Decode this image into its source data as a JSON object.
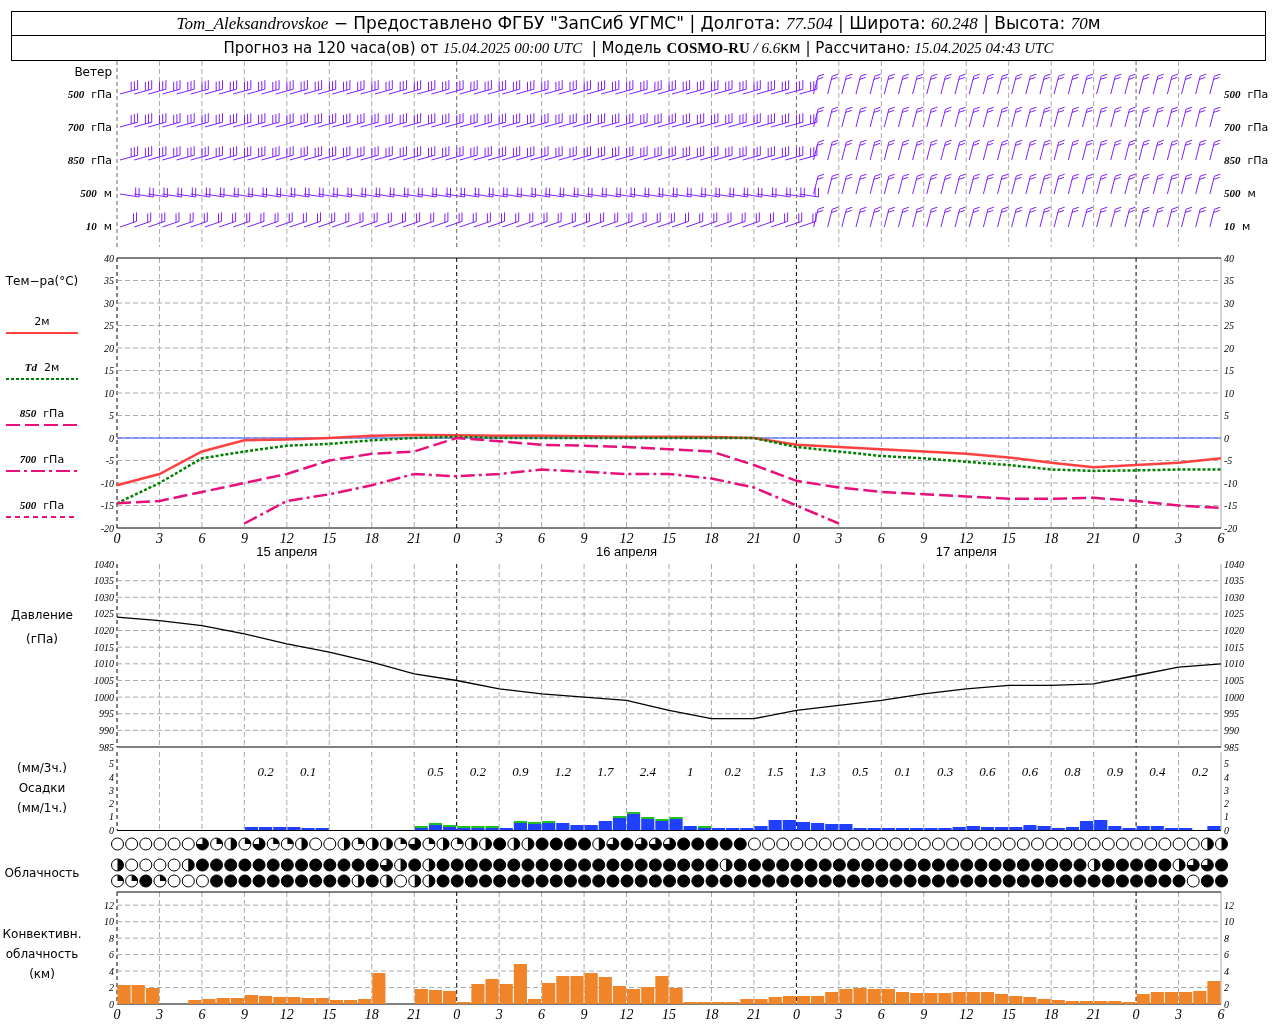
{
  "header": {
    "line_1": [
      {
        "text": "Tom_Aleksandrovskoe"
      },
      {
        "text": " − Предоставлено ФГБУ \"ЗапСиб УГМС\" | Долгота: "
      },
      {
        "text": "77.504"
      },
      {
        "text": " | Широта: "
      },
      {
        "text": "60.248"
      },
      {
        "text": " | Высота: "
      },
      {
        "text": "70"
      },
      {
        "text": "м"
      }
    ],
    "line_2": [
      {
        "text": "Прогноз на 120 часа(ов) от "
      },
      {
        "text": "15.04.2025 00:00 UTC"
      },
      {
        "text": "  | Модель "
      },
      {
        "text": "COSMO-RU"
      },
      {
        "text": " / 6.6"
      },
      {
        "text": "км | Рассчитано"
      },
      {
        "text": ": 15.04.2025 04:43 UTC"
      }
    ]
  },
  "wind": {
    "title": "Ветер",
    "levels": [
      {
        "number": "500",
        "unit": "гПа",
        "right_number": "500",
        "right_unit": "гПа"
      },
      {
        "number": "700",
        "unit": "гПа",
        "right_number": "700",
        "right_unit": "гПа"
      },
      {
        "number": "850",
        "unit": "гПа",
        "right_number": "850",
        "right_unit": "гПа"
      },
      {
        "number": "500",
        "unit": "м",
        "right_number": "500",
        "right_unit": "м"
      },
      {
        "number": "10",
        "unit": "м",
        "right_number": "10",
        "right_unit": "м"
      }
    ]
  },
  "temperature": {
    "title": "Тем−ра(°C)",
    "legend": [
      {
        "unit": "2м",
        "kind": "solid",
        "color": "#ff4040"
      },
      {
        "number": "Td",
        "unit": "2м",
        "kind": "dotted",
        "color": "#008000"
      },
      {
        "number": "850",
        "unit": "гПа",
        "kind": "dashed",
        "color": "#e8107a"
      },
      {
        "number": "700",
        "unit": "гПа",
        "kind": "dashdot",
        "color": "#e8107a"
      },
      {
        "number": "500",
        "unit": "гПа",
        "kind": "shortdash",
        "color": "#e8107a"
      }
    ],
    "dates": [
      "15 апреля",
      "16 апреля",
      "17 апреля"
    ],
    "chart_data": {
      "type": "line",
      "grid": true,
      "categories": [
        "0",
        "3",
        "6",
        "9",
        "12",
        "15",
        "18",
        "21",
        "0",
        "3",
        "6",
        "9",
        "12",
        "15",
        "18",
        "21",
        "0",
        "3",
        "6",
        "9",
        "12",
        "15",
        "18",
        "21",
        "0",
        "3",
        "6"
      ],
      "ylim": [
        -20,
        40
      ],
      "yticks": [
        -20,
        -15,
        -10,
        -5,
        0,
        5,
        10,
        15,
        20,
        25,
        30,
        35,
        40
      ],
      "ref_lines": [
        {
          "axis": "y",
          "value": 0,
          "color": "#3050ff"
        }
      ],
      "series": [
        {
          "color": "#ff4040",
          "line_style": "solid",
          "values": [
            -10.5,
            -8,
            -3,
            -0.5,
            -0.3,
            0,
            0.5,
            0.7,
            0.6,
            0.5,
            0.5,
            0.4,
            0.3,
            0.3,
            0.2,
            0,
            -1.5,
            -2,
            -2.5,
            -3,
            -3.5,
            -4.3,
            -5.5,
            -6.5,
            -6,
            -5.5,
            -4.5
          ]
        },
        {
          "color": "#008000",
          "line_style": "dotted",
          "values": [
            -14.5,
            -10,
            -4.5,
            -3,
            -1.7,
            -1.3,
            -0.5,
            0,
            0.3,
            0,
            0,
            0,
            0,
            0,
            0,
            0,
            -2,
            -3,
            -4,
            -4.5,
            -5.3,
            -6,
            -7,
            -7.3,
            -7.2,
            -7,
            -7
          ]
        },
        {
          "color": "#e8107a",
          "line_style": "dashed",
          "values": [
            -14.5,
            -14,
            -12,
            -10,
            -8,
            -5,
            -3.5,
            -3,
            0,
            -0.7,
            -1.5,
            -1.7,
            -2,
            -2.5,
            -3,
            -6,
            -9.5,
            -11,
            -12,
            -12.5,
            -13,
            -13.5,
            -13.5,
            -13.3,
            -14,
            -15,
            -15.5
          ]
        },
        {
          "color": "#e8107a",
          "line_style": "dashdot",
          "values": [
            null,
            null,
            null,
            -19,
            -14,
            -12.5,
            -10.5,
            -8,
            -8.5,
            -8,
            -7,
            -7.5,
            -8,
            -8,
            -9,
            -11,
            -15,
            -19,
            null,
            null,
            null,
            null,
            null,
            null,
            null,
            null,
            null
          ]
        }
      ]
    },
    "right_ticks": [
      "40",
      "35",
      "30",
      "25",
      "20",
      "15",
      "10",
      "5",
      "0",
      "-5",
      "-10",
      "-15",
      "-20"
    ]
  },
  "pressure": {
    "title": "Давление",
    "unit": "(гПа)",
    "chart_data": {
      "type": "line",
      "grid": true,
      "categories": [
        null,
        null,
        null,
        null,
        null,
        null,
        null,
        null,
        null,
        null,
        null,
        null,
        null,
        null,
        null,
        null,
        null,
        null,
        null,
        null,
        null,
        null,
        null,
        null,
        null,
        null,
        null
      ],
      "ylim": [
        985,
        1040
      ],
      "yticks": [
        985,
        990,
        995,
        1000,
        1005,
        1010,
        1015,
        1020,
        1025,
        1030,
        1035,
        1040
      ],
      "series": [
        {
          "color": "#000000",
          "line_style": "solid",
          "values": [
            1024,
            1023,
            1021.5,
            1019,
            1016,
            1013.5,
            1010.5,
            1007,
            1005,
            1002.5,
            1001,
            1000,
            999,
            996,
            993.5,
            993.5,
            996,
            997.5,
            999,
            1001,
            1002.5,
            1003.5,
            1003.5,
            1004,
            1006.5,
            1009,
            1010
          ]
        }
      ]
    },
    "right_ticks": [
      "1040",
      "1035",
      "1030",
      "1025",
      "1020",
      "1015",
      "1010",
      "1005",
      "1000",
      "995",
      "990",
      "985"
    ]
  },
  "precipitation": {
    "unit_3h": "(мм/3ч.)",
    "title": "Осадки",
    "unit_1h": "(мм/1ч.)",
    "right_ticks": [
      "5",
      "4",
      "3",
      "2",
      "1",
      "0"
    ],
    "chart_data": {
      "type": "bar",
      "grid": true,
      "stacked": true,
      "ylim": [
        0,
        5.9
      ],
      "yticks": [
        0,
        1,
        2,
        3,
        4,
        5
      ],
      "categories": [
        null,
        null,
        null,
        null,
        null,
        null,
        null,
        null,
        null,
        null,
        null,
        null,
        null,
        null,
        null,
        null,
        null,
        null,
        null,
        null,
        null,
        null,
        null,
        null,
        null,
        null,
        null,
        null,
        null,
        null,
        null,
        null,
        null,
        null,
        null,
        null,
        null,
        null,
        null,
        null,
        null,
        null,
        null,
        null,
        null,
        null,
        null,
        null,
        null,
        null,
        null,
        null,
        null,
        null,
        null,
        null,
        null,
        null,
        null,
        null,
        null,
        null,
        null,
        null,
        null,
        null,
        null,
        null,
        null,
        null,
        null,
        null,
        null,
        null,
        null,
        null,
        null,
        null
      ],
      "series": [
        {
          "color": "#2040ff",
          "values": [
            0,
            0,
            0,
            0,
            0,
            0,
            0,
            0,
            0,
            0.2,
            0.2,
            0.2,
            0.2,
            0.15,
            0.1,
            0,
            0,
            0,
            0,
            0,
            0,
            0.15,
            0.4,
            0.2,
            0.15,
            0.05,
            0.05,
            0.05,
            0.5,
            0.45,
            0.5,
            0.5,
            0.4,
            0.35,
            0.7,
            0.9,
            1.2,
            0.8,
            0.7,
            0.8,
            0.3,
            0.1,
            0.15,
            0.15,
            0.15,
            0.3,
            0.75,
            0.75,
            0.6,
            0.5,
            0.45,
            0.45,
            0.05,
            0.1,
            0.1,
            0.05,
            0.1,
            0.1,
            0.1,
            0.25,
            0.3,
            0.25,
            0.2,
            0.2,
            0.35,
            0.3,
            0.1,
            0.2,
            0.65,
            0.75,
            0.3,
            0.15,
            0.3,
            0.3,
            0.15,
            0.15,
            0,
            0.3
          ]
        },
        {
          "color": "#20c020",
          "values": [
            0,
            0,
            0,
            0,
            0,
            0,
            0,
            0,
            0,
            0,
            0,
            0,
            0,
            0,
            0,
            0,
            0,
            0,
            0,
            0,
            0,
            0.05,
            0.05,
            0.1,
            0.05,
            0.1,
            0.1,
            0,
            0.1,
            0.1,
            0.1,
            0,
            0,
            0,
            0,
            0.05,
            0.1,
            0.05,
            0.05,
            0.1,
            0,
            0.1,
            0,
            0,
            0,
            0,
            0,
            0,
            0,
            0,
            0,
            0,
            0,
            0,
            0,
            0,
            0,
            0,
            0,
            0,
            0,
            0,
            0,
            0,
            0,
            0,
            0,
            0,
            0,
            0,
            0,
            0,
            0,
            0,
            0,
            0,
            0,
            0
          ]
        }
      ]
    },
    "totals_3h": [
      "0.2",
      "0.1",
      "0.5",
      "0.2",
      "0.9",
      "1.2",
      "1.7",
      "2.4",
      "1",
      "0.2",
      "1.5",
      "1.3",
      "0.5",
      "0.1",
      "0.3",
      "0.6",
      "0.6",
      "0.8",
      "0.9",
      "0.4",
      "0.2"
    ]
  },
  "cloudiness": {
    "title": "Облачность",
    "rows": [
      {
        "cells": [
          {
            "kind": "clear"
          },
          {
            "kind": "clear"
          },
          {
            "kind": "clear"
          },
          {
            "kind": "clear"
          },
          {
            "kind": "clear"
          },
          {
            "kind": "clear"
          },
          {
            "kind": "most"
          },
          {
            "kind": "quarter"
          },
          {
            "kind": "half"
          },
          {
            "kind": "quarter"
          },
          {
            "kind": "most"
          },
          {
            "kind": "quarter"
          },
          {
            "kind": "quarter"
          },
          {
            "kind": "half"
          },
          {
            "kind": "clear"
          },
          {
            "kind": "clear"
          },
          {
            "kind": "half"
          },
          {
            "kind": "quarter"
          },
          {
            "kind": "half"
          },
          {
            "kind": "half"
          },
          {
            "kind": "quarter"
          },
          {
            "kind": "most"
          },
          {
            "kind": "quarter"
          },
          {
            "kind": "half"
          },
          {
            "kind": "quarter"
          },
          {
            "kind": "half"
          },
          {
            "kind": "half"
          },
          {
            "kind": "overcast"
          },
          {
            "kind": "half"
          },
          {
            "kind": "half"
          },
          {
            "kind": "overcast"
          },
          {
            "kind": "overcast"
          },
          {
            "kind": "overcast"
          },
          {
            "kind": "overcast"
          },
          {
            "kind": "half"
          },
          {
            "kind": "most"
          },
          {
            "kind": "overcast"
          },
          {
            "kind": "most"
          },
          {
            "kind": "most"
          },
          {
            "kind": "most"
          },
          {
            "kind": "overcast"
          },
          {
            "kind": "overcast"
          },
          {
            "kind": "overcast"
          },
          {
            "kind": "overcast"
          },
          {
            "kind": "overcast"
          },
          {
            "kind": "clear"
          },
          {
            "kind": "clear"
          },
          {
            "kind": "clear"
          },
          {
            "kind": "clear"
          },
          {
            "kind": "clear"
          },
          {
            "kind": "clear"
          },
          {
            "kind": "clear"
          },
          {
            "kind": "clear"
          },
          {
            "kind": "clear"
          },
          {
            "kind": "clear"
          },
          {
            "kind": "clear"
          },
          {
            "kind": "clear"
          },
          {
            "kind": "clear"
          },
          {
            "kind": "clear"
          },
          {
            "kind": "clear"
          },
          {
            "kind": "clear"
          },
          {
            "kind": "clear"
          },
          {
            "kind": "clear"
          },
          {
            "kind": "clear"
          },
          {
            "kind": "clear"
          },
          {
            "kind": "clear"
          },
          {
            "kind": "clear"
          },
          {
            "kind": "clear"
          },
          {
            "kind": "clear"
          },
          {
            "kind": "clear"
          },
          {
            "kind": "clear"
          },
          {
            "kind": "clear"
          },
          {
            "kind": "clear"
          },
          {
            "kind": "clear"
          },
          {
            "kind": "clear"
          },
          {
            "kind": "clear"
          },
          {
            "kind": "clear"
          },
          {
            "kind": "half"
          },
          {
            "kind": "half"
          }
        ]
      },
      {
        "cells": [
          {
            "kind": "half"
          },
          {
            "kind": "clear"
          },
          {
            "kind": "clear"
          },
          {
            "kind": "clear"
          },
          {
            "kind": "clear"
          },
          {
            "kind": "half"
          },
          {
            "kind": "overcast"
          },
          {
            "kind": "overcast"
          },
          {
            "kind": "overcast"
          },
          {
            "kind": "overcast"
          },
          {
            "kind": "overcast"
          },
          {
            "kind": "overcast"
          },
          {
            "kind": "overcast"
          },
          {
            "kind": "overcast"
          },
          {
            "kind": "overcast"
          },
          {
            "kind": "overcast"
          },
          {
            "kind": "overcast"
          },
          {
            "kind": "overcast"
          },
          {
            "kind": "overcast"
          },
          {
            "kind": "most"
          },
          {
            "kind": "half"
          },
          {
            "kind": "overcast"
          },
          {
            "kind": "half"
          },
          {
            "kind": "overcast"
          },
          {
            "kind": "overcast"
          },
          {
            "kind": "overcast"
          },
          {
            "kind": "overcast"
          },
          {
            "kind": "overcast"
          },
          {
            "kind": "overcast"
          },
          {
            "kind": "overcast"
          },
          {
            "kind": "overcast"
          },
          {
            "kind": "overcast"
          },
          {
            "kind": "overcast"
          },
          {
            "kind": "overcast"
          },
          {
            "kind": "overcast"
          },
          {
            "kind": "overcast"
          },
          {
            "kind": "overcast"
          },
          {
            "kind": "overcast"
          },
          {
            "kind": "overcast"
          },
          {
            "kind": "overcast"
          },
          {
            "kind": "overcast"
          },
          {
            "kind": "overcast"
          },
          {
            "kind": "overcast"
          },
          {
            "kind": "half"
          },
          {
            "kind": "overcast"
          },
          {
            "kind": "overcast"
          },
          {
            "kind": "overcast"
          },
          {
            "kind": "overcast"
          },
          {
            "kind": "overcast"
          },
          {
            "kind": "overcast"
          },
          {
            "kind": "overcast"
          },
          {
            "kind": "overcast"
          },
          {
            "kind": "overcast"
          },
          {
            "kind": "overcast"
          },
          {
            "kind": "overcast"
          },
          {
            "kind": "overcast"
          },
          {
            "kind": "overcast"
          },
          {
            "kind": "overcast"
          },
          {
            "kind": "overcast"
          },
          {
            "kind": "overcast"
          },
          {
            "kind": "overcast"
          },
          {
            "kind": "overcast"
          },
          {
            "kind": "overcast"
          },
          {
            "kind": "overcast"
          },
          {
            "kind": "overcast"
          },
          {
            "kind": "overcast"
          },
          {
            "kind": "overcast"
          },
          {
            "kind": "overcast"
          },
          {
            "kind": "overcast"
          },
          {
            "kind": "half"
          },
          {
            "kind": "overcast"
          },
          {
            "kind": "overcast"
          },
          {
            "kind": "overcast"
          },
          {
            "kind": "overcast"
          },
          {
            "kind": "overcast"
          },
          {
            "kind": "half"
          },
          {
            "kind": "most"
          },
          {
            "kind": "most"
          },
          {
            "kind": "overcast"
          }
        ]
      },
      {
        "cells": [
          {
            "kind": "quarter"
          },
          {
            "kind": "quarter"
          },
          {
            "kind": "overcast"
          },
          {
            "kind": "quarter"
          },
          {
            "kind": "clear"
          },
          {
            "kind": "clear"
          },
          {
            "kind": "clear"
          },
          {
            "kind": "overcast"
          },
          {
            "kind": "overcast"
          },
          {
            "kind": "overcast"
          },
          {
            "kind": "overcast"
          },
          {
            "kind": "overcast"
          },
          {
            "kind": "overcast"
          },
          {
            "kind": "overcast"
          },
          {
            "kind": "overcast"
          },
          {
            "kind": "overcast"
          },
          {
            "kind": "overcast"
          },
          {
            "kind": "half"
          },
          {
            "kind": "overcast"
          },
          {
            "kind": "half"
          },
          {
            "kind": "clear"
          },
          {
            "kind": "half"
          },
          {
            "kind": "half"
          },
          {
            "kind": "overcast"
          },
          {
            "kind": "overcast"
          },
          {
            "kind": "overcast"
          },
          {
            "kind": "overcast"
          },
          {
            "kind": "overcast"
          },
          {
            "kind": "overcast"
          },
          {
            "kind": "overcast"
          },
          {
            "kind": "overcast"
          },
          {
            "kind": "overcast"
          },
          {
            "kind": "overcast"
          },
          {
            "kind": "overcast"
          },
          {
            "kind": "overcast"
          },
          {
            "kind": "overcast"
          },
          {
            "kind": "overcast"
          },
          {
            "kind": "overcast"
          },
          {
            "kind": "overcast"
          },
          {
            "kind": "overcast"
          },
          {
            "kind": "overcast"
          },
          {
            "kind": "overcast"
          },
          {
            "kind": "overcast"
          },
          {
            "kind": "overcast"
          },
          {
            "kind": "overcast"
          },
          {
            "kind": "overcast"
          },
          {
            "kind": "overcast"
          },
          {
            "kind": "overcast"
          },
          {
            "kind": "overcast"
          },
          {
            "kind": "overcast"
          },
          {
            "kind": "overcast"
          },
          {
            "kind": "overcast"
          },
          {
            "kind": "overcast"
          },
          {
            "kind": "overcast"
          },
          {
            "kind": "overcast"
          },
          {
            "kind": "overcast"
          },
          {
            "kind": "overcast"
          },
          {
            "kind": "overcast"
          },
          {
            "kind": "overcast"
          },
          {
            "kind": "overcast"
          },
          {
            "kind": "overcast"
          },
          {
            "kind": "overcast"
          },
          {
            "kind": "overcast"
          },
          {
            "kind": "overcast"
          },
          {
            "kind": "overcast"
          },
          {
            "kind": "overcast"
          },
          {
            "kind": "overcast"
          },
          {
            "kind": "overcast"
          },
          {
            "kind": "overcast"
          },
          {
            "kind": "overcast"
          },
          {
            "kind": "overcast"
          },
          {
            "kind": "overcast"
          },
          {
            "kind": "overcast"
          },
          {
            "kind": "overcast"
          },
          {
            "kind": "overcast"
          },
          {
            "kind": "overcast"
          },
          {
            "kind": "clear"
          },
          {
            "kind": "overcast"
          },
          {
            "kind": "overcast"
          }
        ]
      }
    ]
  },
  "convective": {
    "title": "Конвективн.",
    "subtitle": "облачность",
    "unit": "(км)",
    "hour_labels": [
      "0",
      "3",
      "6",
      "9",
      "12",
      "15",
      "18",
      "21",
      "0",
      "3",
      "6",
      "9",
      "12",
      "15",
      "18",
      "21",
      "0",
      "3",
      "6",
      "9",
      "12",
      "15",
      "18",
      "21",
      "0",
      "3",
      "6"
    ],
    "right_ticks": [
      "12",
      "10",
      "8",
      "6",
      "4",
      "2",
      "0"
    ],
    "chart_data": {
      "type": "bar",
      "grid": true,
      "ylim": [
        0,
        13.6
      ],
      "yticks": [
        0,
        2,
        4,
        6,
        8,
        10,
        12
      ],
      "categories": [
        null,
        null,
        null,
        null,
        null,
        null,
        null,
        null,
        null,
        null,
        null,
        null,
        null,
        null,
        null,
        null,
        null,
        null,
        null,
        null,
        null,
        null,
        null,
        null,
        null,
        null,
        null,
        null,
        null,
        null,
        null,
        null,
        null,
        null,
        null,
        null,
        null,
        null,
        null,
        null,
        null,
        null,
        null,
        null,
        null,
        null,
        null,
        null,
        null,
        null,
        null,
        null,
        null,
        null,
        null,
        null,
        null,
        null,
        null,
        null,
        null,
        null,
        null,
        null,
        null,
        null,
        null,
        null,
        null,
        null,
        null,
        null,
        null,
        null,
        null,
        null,
        null,
        null
      ],
      "series": [
        {
          "color": "#f08428",
          "values": [
            2.3,
            2.3,
            2,
            0,
            0,
            0.5,
            0.6,
            0.7,
            0.7,
            1.1,
            1,
            0.9,
            0.9,
            0.7,
            0.7,
            0.5,
            0.5,
            0.6,
            3.8,
            0,
            0,
            1.8,
            1.7,
            1.6,
            0.3,
            2.4,
            3,
            2.4,
            4.8,
            0.6,
            2.6,
            3.4,
            3.4,
            3.8,
            3.3,
            2.2,
            1.8,
            2.1,
            3.4,
            2,
            0.3,
            0.2,
            0.2,
            0.2,
            0.6,
            0.6,
            0.9,
            1,
            1,
            1,
            1.5,
            1.8,
            2,
            1.8,
            1.8,
            1.5,
            1.3,
            1.3,
            1.3,
            1.5,
            1.5,
            1.5,
            1.2,
            1,
            0.8,
            0.6,
            0.5,
            0.4,
            0.4,
            0.4,
            0.4,
            0.3,
            1.2,
            1.5,
            1.5,
            1.5,
            1.6,
            2.8
          ]
        }
      ]
    }
  }
}
